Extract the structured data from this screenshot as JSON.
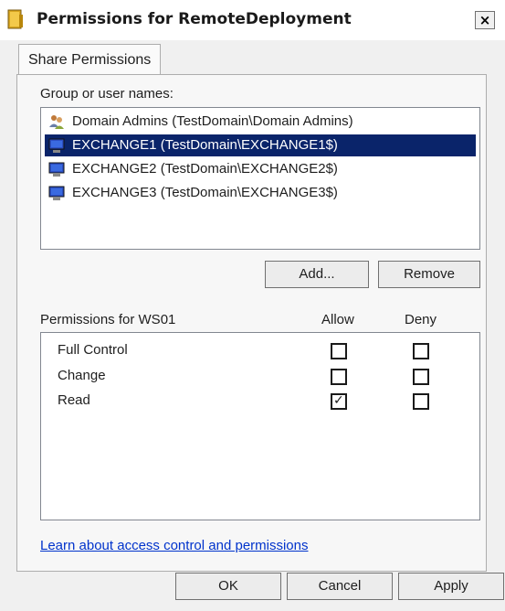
{
  "window": {
    "title": "Permissions for RemoteDeployment",
    "close_label": "×"
  },
  "tab": {
    "label": "Share Permissions"
  },
  "group_section": {
    "label": "Group or user names:",
    "items": [
      {
        "label": "Domain Admins (TestDomain\\Domain Admins)",
        "icon": "users-group-icon",
        "selected": false
      },
      {
        "label": "EXCHANGE1 (TestDomain\\EXCHANGE1$)",
        "icon": "computer-icon",
        "selected": true
      },
      {
        "label": "EXCHANGE2 (TestDomain\\EXCHANGE2$)",
        "icon": "computer-icon",
        "selected": false
      },
      {
        "label": "EXCHANGE3 (TestDomain\\EXCHANGE3$)",
        "icon": "computer-icon",
        "selected": false
      }
    ],
    "add_label": "Add...",
    "remove_label": "Remove"
  },
  "permissions": {
    "header_label": "Permissions for WS01",
    "allow_label": "Allow",
    "deny_label": "Deny",
    "rows": [
      {
        "name": "Full Control",
        "allow": false,
        "deny": false
      },
      {
        "name": "Change",
        "allow": false,
        "deny": false
      },
      {
        "name": "Read",
        "allow": true,
        "deny": false
      }
    ]
  },
  "link_label": "Learn about access control and permissions",
  "buttons": {
    "ok_label": "OK",
    "cancel_label": "Cancel",
    "apply_label": "Apply"
  },
  "colors": {
    "selection": "#0a246a",
    "link": "#0033cc"
  }
}
